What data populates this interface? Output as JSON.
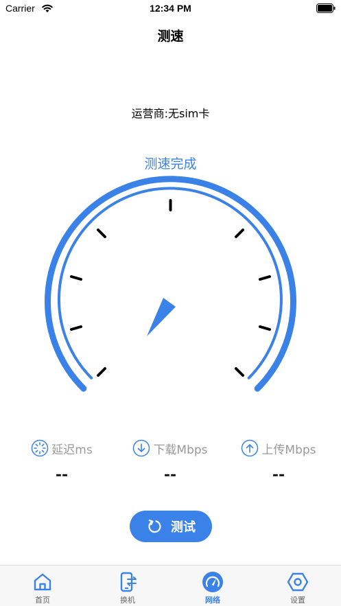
{
  "status_bar": {
    "carrier": "Carrier",
    "time": "12:34 PM"
  },
  "nav": {
    "title": "测速"
  },
  "carrier_info": "运营商:无sim卡",
  "test_status": "测速完成",
  "metrics": [
    {
      "icon": "latency-icon",
      "label": "延迟ms",
      "value": "--"
    },
    {
      "icon": "download-icon",
      "label": "下载Mbps",
      "value": "--"
    },
    {
      "icon": "upload-icon",
      "label": "上传Mbps",
      "value": "--"
    }
  ],
  "test_button": {
    "label": "测试",
    "icon": "refresh-icon"
  },
  "tab_bar": {
    "active": "网络",
    "items": [
      {
        "label": "首页",
        "icon": "home-icon"
      },
      {
        "label": "换机",
        "icon": "phone-transfer-icon"
      },
      {
        "label": "网络",
        "icon": "speedometer-icon"
      },
      {
        "label": "设置",
        "icon": "settings-icon"
      }
    ]
  },
  "colors": {
    "accent": "#3b82e8",
    "muted_text": "#999999",
    "tab_bar_bg": "#f7f7f7"
  }
}
